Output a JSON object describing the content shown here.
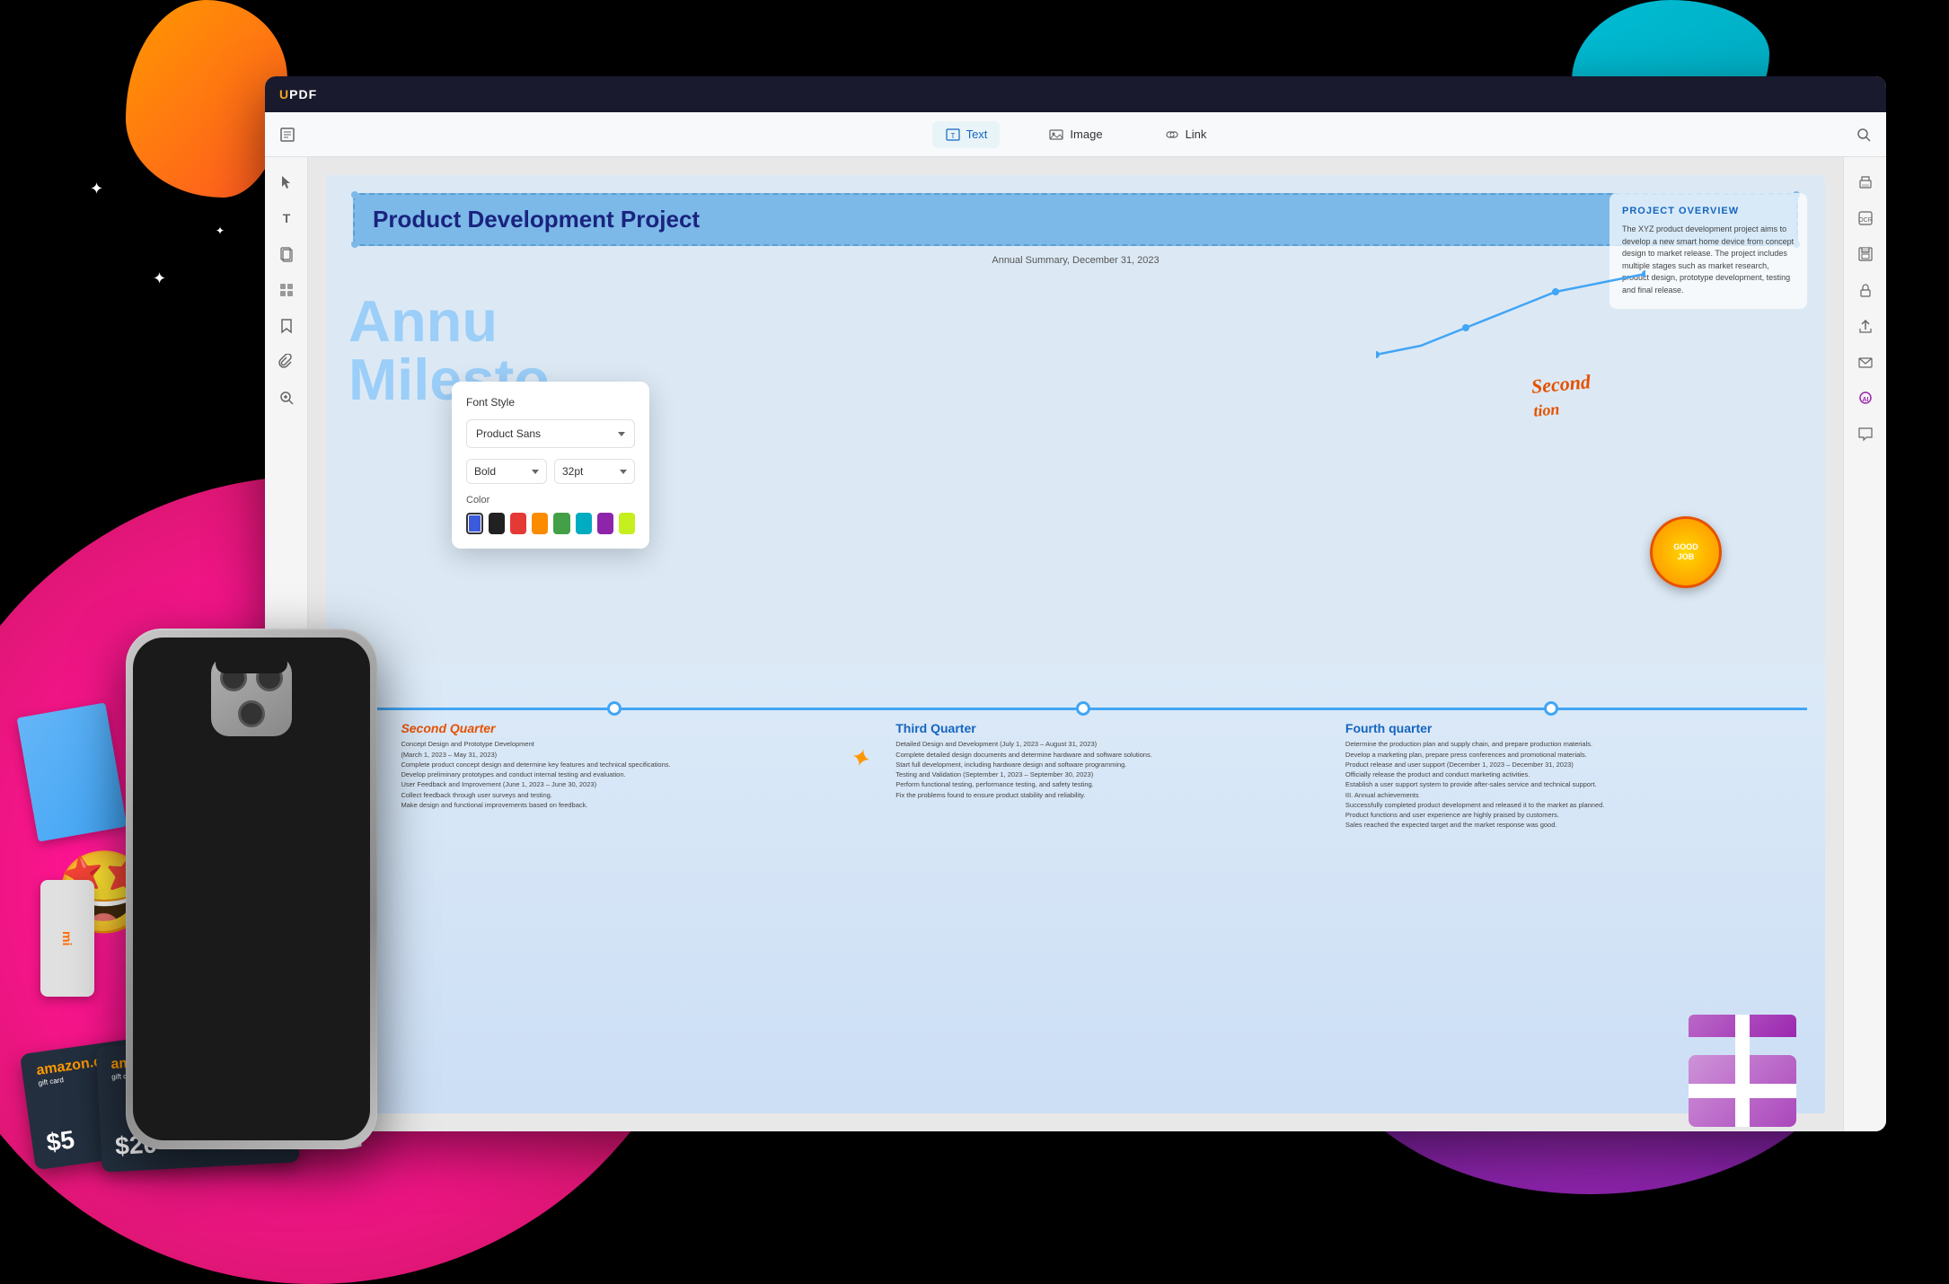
{
  "app": {
    "title_logo": "UPDF",
    "title_logo_accent": "U"
  },
  "toolbar": {
    "text_label": "Text",
    "image_label": "Image",
    "link_label": "Link",
    "search_icon": "🔍"
  },
  "left_sidebar": {
    "icons": [
      "📄",
      "🖊",
      "📋",
      "📐",
      "🔖",
      "📌",
      "🔍"
    ]
  },
  "right_sidebar": {
    "icons": [
      "🖨",
      "💾",
      "🔒",
      "📤",
      "✉",
      "📊",
      "💬"
    ]
  },
  "pdf": {
    "title": "Product Development Project",
    "subtitle": "Annual Summary,                    December 31, 2023",
    "annual_label": "Annu",
    "milesto_label": "Milesto",
    "project_overview": {
      "title": "PROJECT OVERVIEW",
      "text": "The XYZ product development project aims to develop a new smart home device from concept design to market release. The project includes multiple stages such as market research, product design, prototype development, testing and final release."
    },
    "second_quarter": {
      "title": "Second Quarter",
      "body": "Concept Design and Prototype Development\n(March 1, 2023 – May 31, 2023)\nComplete product concept design and determine key features and technical specifications.\nDevelop preliminary prototypes and conduct internal testing and evaluation.\nUser Feedback and Improvement (June 1, 2023 – June 30, 2023)\nCollect feedback through user surveys and testing.\nMake design and functional improvements based on feedback."
    },
    "third_quarter": {
      "title": "Third Quarter",
      "body": "Detailed Design and Development (July 1, 2023 – August 31, 2023)\nComplete detailed design documents and determine hardware and software solutions.\nStart full development, including hardware design and software programming.\nTesting and Validation (September 1, 2023 – September 30, 2023)\nPerform functional testing, performance testing, and safety testing.\nFix the problems found to ensure product stability and reliability."
    },
    "fourth_quarter": {
      "title": "Fourth quarter",
      "body": "Determine the production plan and supply chain, and prepare production materials.\nDevelop a marketing plan, prepare press conferences and promotional materials.\nProduct release and user support (December 1, 2023 – December 31, 2023)\nOfficially release the product and conduct marketing activities.\nEstablish a user support system to provide after-sales service and technical support.\nIII. Annual achievements\nSuccessfully completed product development and released it to the market as planned.\nProduct functions and user experience are highly praised by customers.\nSales reached the expected target and the market response was good."
    }
  },
  "font_popup": {
    "title": "Font Style",
    "font_name": "Product Sans",
    "font_style": "Bold",
    "font_size": "32pt",
    "color_label": "Color",
    "colors": [
      {
        "name": "blue",
        "hex": "#3b5bdb",
        "selected": true
      },
      {
        "name": "black",
        "hex": "#212121"
      },
      {
        "name": "red",
        "hex": "#e53935"
      },
      {
        "name": "orange",
        "hex": "#fb8c00"
      },
      {
        "name": "green",
        "hex": "#43a047"
      },
      {
        "name": "teal",
        "hex": "#00acc1"
      },
      {
        "name": "purple",
        "hex": "#8e24aa"
      },
      {
        "name": "yellow-green",
        "hex": "#c6ef1e"
      }
    ]
  },
  "decorative": {
    "amazon_5_logo": "amazon.com",
    "amazon_5_sub": "gift card",
    "amazon_5_amount": "$5",
    "amazon_20_logo": "amazon.com",
    "amazon_20_sub": "gift card",
    "amazon_20_amount": "$20",
    "mi_label": "mi",
    "good_job_text": "GOOD\nJOB",
    "sparkles": [
      "✦",
      "✦",
      "✦"
    ]
  }
}
